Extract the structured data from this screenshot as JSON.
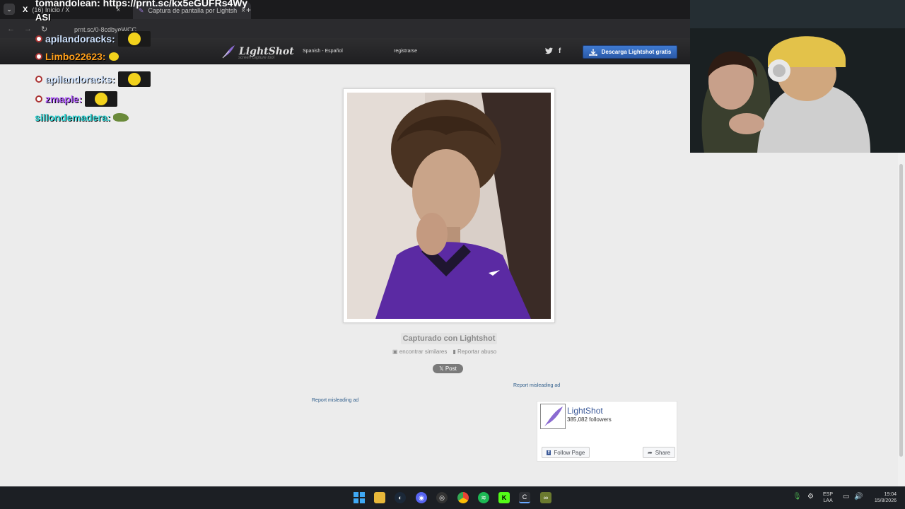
{
  "browser": {
    "tabs": [
      {
        "label": "(16) Inicio / X",
        "logo": "X"
      },
      {
        "label": "Captura de pantalla por Lightsh"
      }
    ],
    "url": "prnt.sc/0-8cdbyeWCC",
    "new_tab_symbol": "+",
    "close_symbol": "×"
  },
  "lightshot_header": {
    "logo_text": "LightShot",
    "logo_subtitle": "screen capture tool",
    "language": "Spanish - Español",
    "register": "registrarse",
    "download_button": "Descarga Lightshot gratis",
    "twitter_symbol": "🐦",
    "facebook_symbol": "f"
  },
  "screenshot_page": {
    "captured_label": "Capturado con Lightshot",
    "find_similar": "encontrar similares",
    "report_abuse": "Reportar abuso",
    "post_button": "Post",
    "report_ad_1": "Report misleading ad",
    "report_ad_2": "Report misleading ad"
  },
  "facebook_widget": {
    "page_name": "LightShot",
    "followers": "385,082 followers",
    "follow_button": "Follow Page",
    "share_button": "Share"
  },
  "stream_overlay": {
    "title": "tomandolean: https://prnt.sc/kx5eGUFRs4Wy",
    "chat": [
      {
        "user": "ASI",
        "color": "#ffffff"
      },
      {
        "user": "apilandoracks:",
        "color": "#cfe3ff"
      },
      {
        "user": "Limbo22623:",
        "color": "#ff9f1a"
      },
      {
        "user": "apilandoracks:",
        "color": "#cfe3ff"
      },
      {
        "user": "zmaple:",
        "color": "#b25cff"
      },
      {
        "user": "sillondemadera:",
        "color": "#37d6d6"
      }
    ]
  },
  "taskbar": {
    "lang_top": "ESP",
    "lang_bottom": "LAA",
    "time": "19:04",
    "date": "15/8/2026"
  },
  "colors": {
    "download_button": "#2b5aa8",
    "facebook_blue": "#3b5998",
    "page_background": "#ececec"
  }
}
